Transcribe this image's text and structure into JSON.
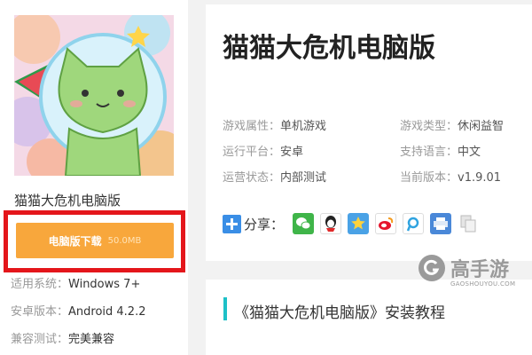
{
  "game": {
    "name": "猫猫大危机电脑版",
    "cover_icon": "cat-astronaut-artwork"
  },
  "download": {
    "label": "电脑版下载",
    "size": "50.0MB",
    "button_color": "#f8a73c",
    "highlight_color": "#e4161b"
  },
  "specs": [
    {
      "key": "适用系统：",
      "value": "Windows 7+"
    },
    {
      "key": "安卓版本：",
      "value": "Android 4.2.2"
    },
    {
      "key": "兼容测试：",
      "value": "完美兼容"
    }
  ],
  "info": {
    "title": "猫猫大危机电脑版",
    "attributes": [
      {
        "key": "游戏属性：",
        "value": "单机游戏"
      },
      {
        "key": "游戏类型：",
        "value": "休闲益智"
      },
      {
        "key": "运行平台：",
        "value": "安卓"
      },
      {
        "key": "支持语言：",
        "value": "中文"
      },
      {
        "key": "运营状态：",
        "value": "内部测试"
      },
      {
        "key": "当前版本：",
        "value": "v1.9.01"
      }
    ]
  },
  "share": {
    "label": "分享：",
    "icons": [
      "wechat-icon",
      "qq-icon",
      "qzone-icon",
      "weibo-icon",
      "tencent-weibo-icon",
      "print-icon",
      "copy-icon"
    ]
  },
  "section": {
    "title": "《猫猫大危机电脑版》安装教程",
    "accent": "#1dc0c7"
  },
  "watermark": {
    "brand": "高手游",
    "url": "GAOSHOUYOU.COM"
  }
}
